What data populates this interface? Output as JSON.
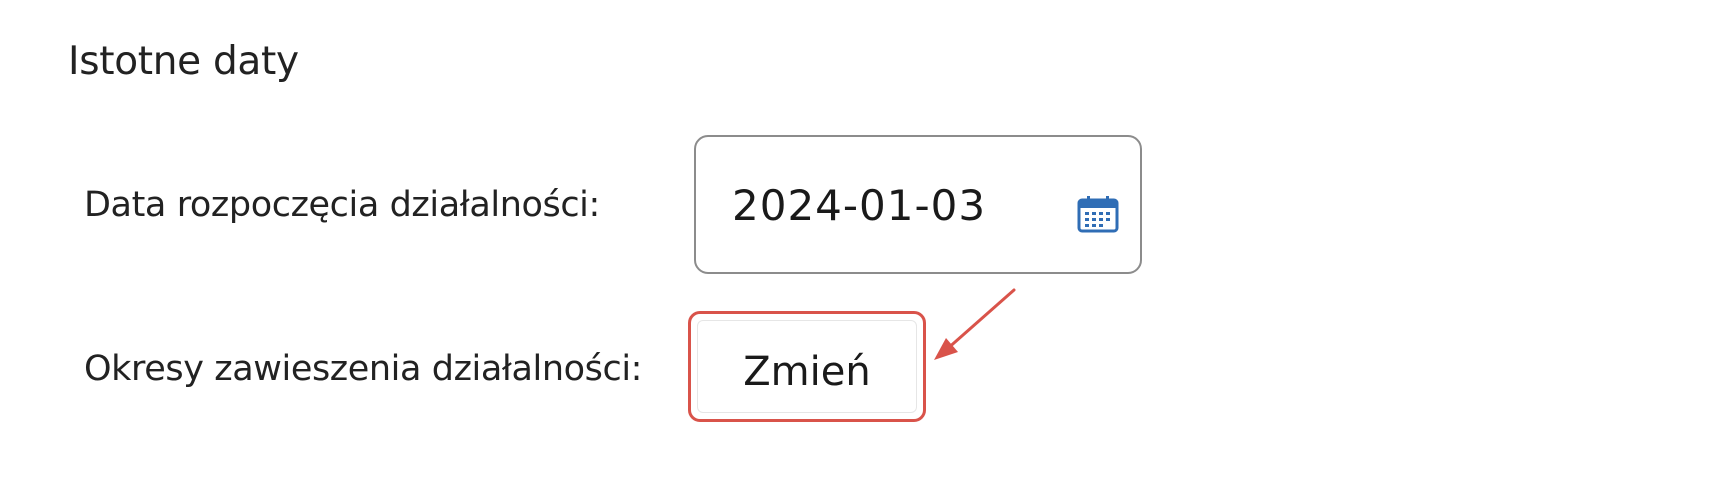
{
  "section": {
    "title": "Istotne daty"
  },
  "fields": {
    "start_label": "Data rozpoczęcia działalności:",
    "start_value": "2024-01-03",
    "suspend_label": "Okresy zawieszenia działalności:",
    "change_label": "Zmień"
  },
  "icons": {
    "calendar": "calendar-icon"
  },
  "colors": {
    "highlight": "#d9534a",
    "calendar_icon": "#2f6db5",
    "input_border": "#8c8c8c"
  }
}
